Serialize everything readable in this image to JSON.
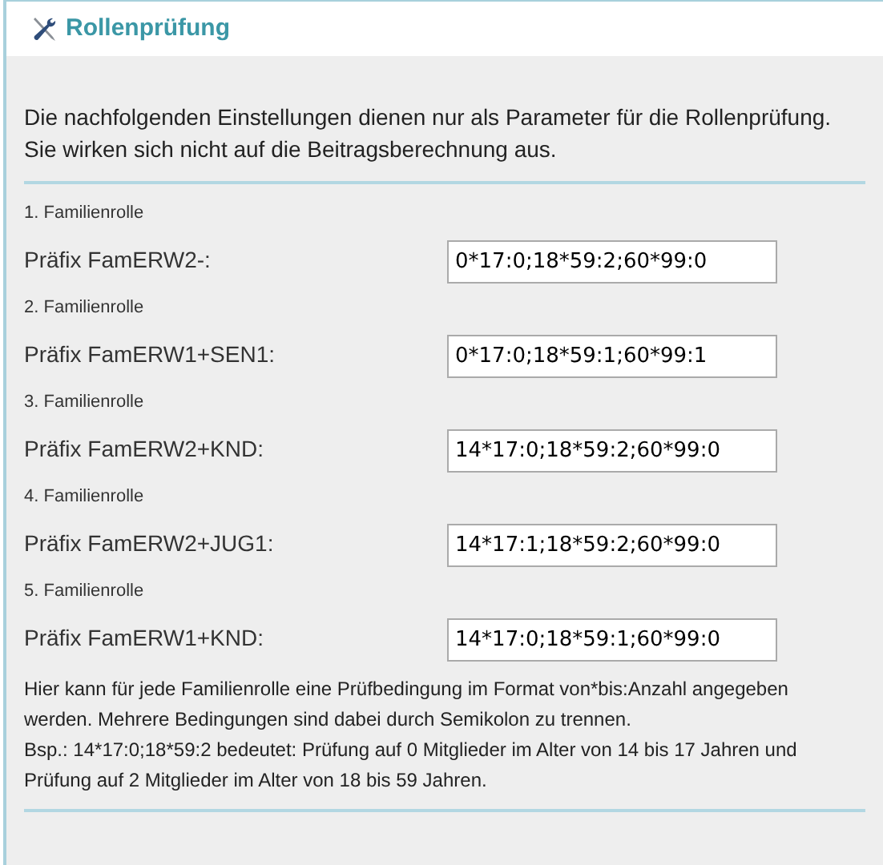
{
  "panel": {
    "title": "Rollenprüfung"
  },
  "intro": [
    "Die nachfolgenden Einstellungen dienen nur als Parameter für die Rollenprüfung.",
    "Sie wirken sich nicht auf die Beitragsberechnung aus."
  ],
  "roles": [
    {
      "heading": "1. Familienrolle",
      "label": "Präfix FamERW2-:",
      "value": "0*17:0;18*59:2;60*99:0"
    },
    {
      "heading": "2. Familienrolle",
      "label": "Präfix FamERW1+SEN1:",
      "value": "0*17:0;18*59:1;60*99:1"
    },
    {
      "heading": "3. Familienrolle",
      "label": "Präfix FamERW2+KND:",
      "value": "14*17:0;18*59:2;60*99:0"
    },
    {
      "heading": "4. Familienrolle",
      "label": "Präfix FamERW2+JUG1:",
      "value": "14*17:1;18*59:2;60*99:0"
    },
    {
      "heading": "5. Familienrolle",
      "label": "Präfix FamERW1+KND:",
      "value": "14*17:0;18*59:1;60*99:0"
    }
  ],
  "help": [
    "Hier kann für jede Familienrolle eine Prüfbedingung im Format von*bis:Anzahl angegeben werden. Mehrere Bedingungen sind dabei durch Semikolon zu trennen.",
    "Bsp.: 14*17:0;18*59:2 bedeutet: Prüfung auf 0 Mitglieder im Alter von 14 bis 17 Jahren und Prüfung auf 2 Mitglieder im Alter von 18 bis 59 Jahren."
  ]
}
